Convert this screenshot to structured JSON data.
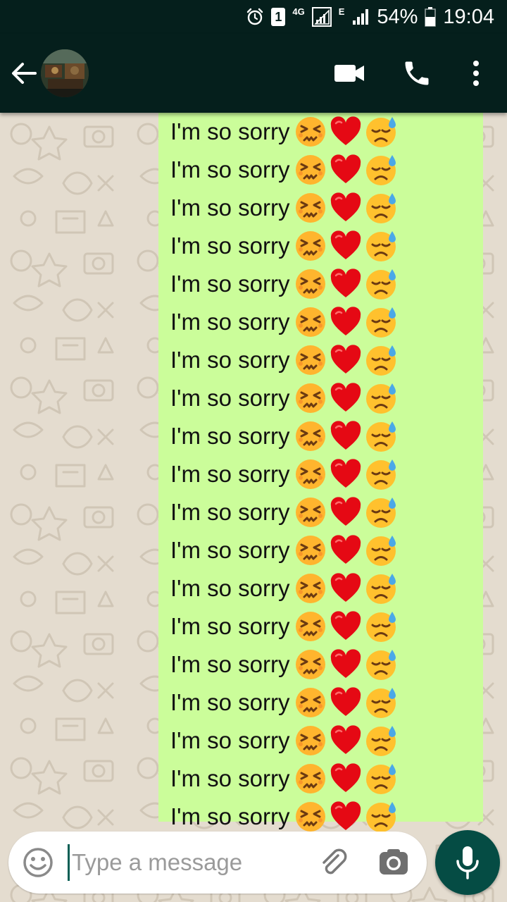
{
  "status_bar": {
    "alarm_icon": "alarm-icon",
    "sim_badge": "1",
    "network_label": "4G",
    "data_label": "E",
    "battery_percent": "54%",
    "time": "19:04",
    "bg_color": "#051f1c"
  },
  "header": {
    "back_icon": "arrow-left-icon",
    "avatar_alt": "contact avatar",
    "video_icon": "video-camera-icon",
    "call_icon": "phone-icon",
    "menu_icon": "more-vert-icon",
    "bg_color": "#051f1c"
  },
  "chat": {
    "bubble_color": "#cbfd9a",
    "messages": [
      {
        "text": "I'm so sorry"
      },
      {
        "text": "I'm so sorry"
      },
      {
        "text": "I'm so sorry"
      },
      {
        "text": "I'm so sorry"
      },
      {
        "text": "I'm so sorry"
      },
      {
        "text": "I'm so sorry"
      },
      {
        "text": "I'm so sorry"
      },
      {
        "text": "I'm so sorry"
      },
      {
        "text": "I'm so sorry"
      },
      {
        "text": "I'm so sorry"
      },
      {
        "text": "I'm so sorry"
      },
      {
        "text": "I'm so sorry"
      },
      {
        "text": "I'm so sorry"
      },
      {
        "text": "I'm so sorry"
      },
      {
        "text": "I'm so sorry"
      },
      {
        "text": "I'm so sorry"
      },
      {
        "text": "I'm so sorry"
      },
      {
        "text": "I'm so sorry"
      },
      {
        "text": "I'm so sorry"
      }
    ],
    "emoji_sequence": [
      "confounded-face-emoji",
      "red-heart-emoji",
      "downcast-face-with-sweat-emoji"
    ]
  },
  "composer": {
    "placeholder": "Type a message",
    "emoji_icon": "smiley-icon",
    "attach_icon": "paperclip-icon",
    "camera_icon": "camera-icon",
    "mic_icon": "microphone-icon",
    "mic_color": "#054c44"
  }
}
